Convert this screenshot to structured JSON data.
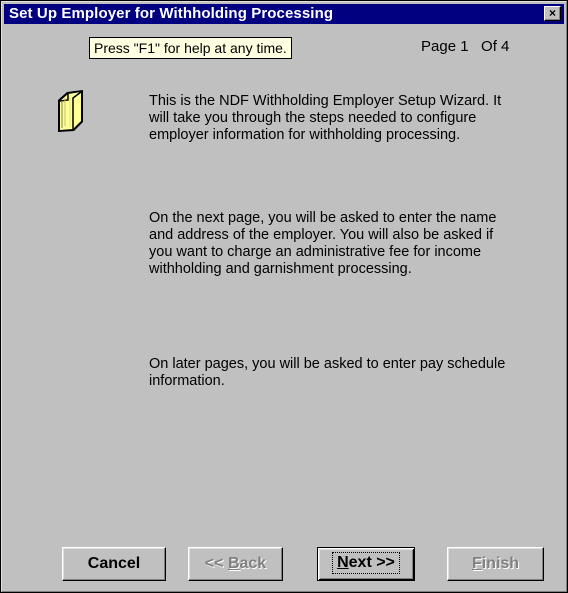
{
  "window": {
    "title": "Set Up Employer for Withholding Processing",
    "close_glyph": "×"
  },
  "tooltip": {
    "text": "Press \"F1\" for help at any time."
  },
  "page_indicator": {
    "text": "Page 1   Of 4"
  },
  "icon": {
    "name": "folder-icon",
    "fill_color": "#ffff99"
  },
  "content": {
    "paragraphs": [
      "This is the NDF Withholding Employer Setup Wizard. It will take you through the steps needed to configure employer information for withholding processing.",
      "On the next page, you will be asked to enter the name and address of the employer. You will also be asked if you want to charge an administrative fee for income withholding and garnishment processing.",
      "On later pages, you will be asked to enter pay schedule information."
    ]
  },
  "buttons": {
    "cancel": {
      "label": "Cancel",
      "enabled": true
    },
    "back": {
      "prefix": "<< ",
      "mnemonic": "B",
      "rest": "ack",
      "enabled": false
    },
    "next": {
      "mnemonic": "N",
      "rest": "ext >>",
      "enabled": true,
      "focused": true
    },
    "finish": {
      "mnemonic": "F",
      "rest": "inish",
      "enabled": false
    }
  },
  "colors": {
    "titlebar": "#000080",
    "face": "#c0c0c0",
    "tooltip_bg": "#ffffe1",
    "disabled_text": "#808080"
  }
}
